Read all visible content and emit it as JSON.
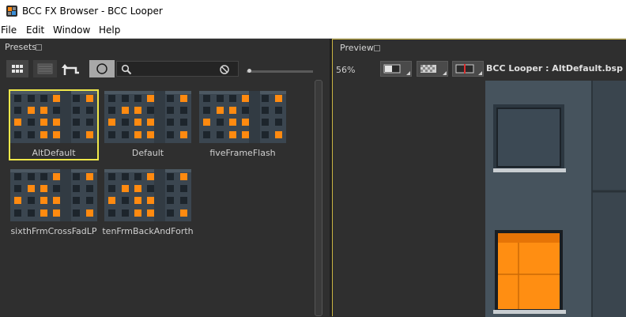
{
  "window": {
    "title": "BCC FX Browser - BCC Looper"
  },
  "menu": {
    "file": "File",
    "edit": "Edit",
    "window": "Window",
    "help": "Help"
  },
  "presets_panel": {
    "title": "Presets",
    "search": {
      "placeholder": "",
      "value": ""
    },
    "items": [
      {
        "label": "AltDefault",
        "selected": true
      },
      {
        "label": "Default",
        "selected": false
      },
      {
        "label": "fiveFrameFlash",
        "selected": false
      },
      {
        "label": "sixthFrmCrossFadLP",
        "selected": false
      },
      {
        "label": "tenFrmBackAndForth",
        "selected": false
      }
    ]
  },
  "preview_panel": {
    "title": "Preview",
    "zoom": "56%",
    "caption": "BCC Looper : AltDefault.bsp"
  },
  "colors": {
    "selection": "#f0e84a",
    "accent_orange": "#ff8a10",
    "panel_border": "#c9b443"
  }
}
